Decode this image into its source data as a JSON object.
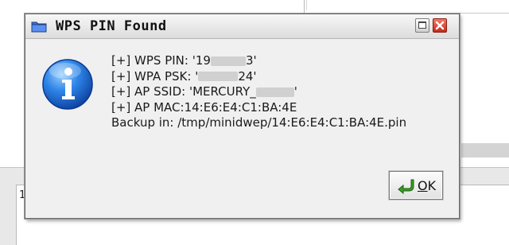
{
  "dialog": {
    "title": "WPS PIN Found",
    "message_lines": [
      {
        "prefix": "[+] WPS PIN: '",
        "visible": "19",
        "suffix": "3'"
      },
      {
        "prefix": "[+] WPA PSK: '",
        "visible": "",
        "suffix": "24'"
      },
      {
        "prefix": "[+] AP SSID: 'MERCURY_",
        "visible": "",
        "suffix": "'"
      },
      {
        "prefix": "[+] AP MAC:14:E6:E4:C1:BA:4E",
        "visible": "",
        "suffix": ""
      },
      {
        "prefix": "Backup in: /tmp/minidwep/14:E6:E4:C1:BA:4E.pin",
        "visible": "",
        "suffix": ""
      }
    ],
    "ok_label_ul": "O",
    "ok_label_rest": "K"
  },
  "icons": {
    "title": "folder-icon",
    "message": "info-icon",
    "ok": "green-return-arrow-icon",
    "maximize": "maximize-icon",
    "close": "close-icon"
  },
  "background": {
    "partial_text": "1"
  },
  "colors": {
    "dialog_bg": "#f0f0f0",
    "close_button": "#d9412f",
    "info_icon_blue": "#1d6fd8",
    "ok_arrow_green": "#3a9d23"
  }
}
